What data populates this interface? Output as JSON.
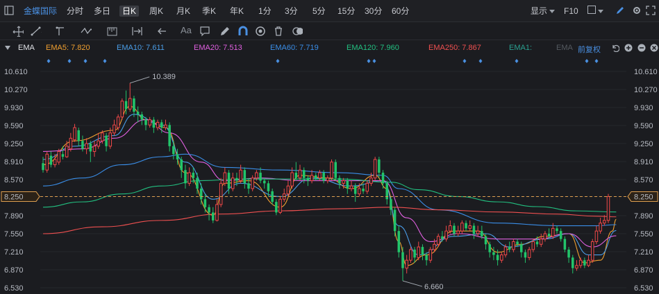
{
  "toolbar": {
    "stock_name": "金蝶国际",
    "periods": [
      "分时",
      "多日",
      "日K",
      "周K",
      "月K",
      "季K",
      "年K",
      "1分",
      "3分",
      "5分",
      "15分",
      "30分",
      "60分"
    ],
    "active_period": "日K",
    "display_label": "显示",
    "f10_label": "F10"
  },
  "drawing_tools": [
    "crosshair-icon",
    "line-icon",
    "ray-icon",
    "wave-icon",
    "ruler-icon",
    "range-icon",
    "arrow-left-icon",
    "text-icon",
    "comment-icon",
    "pen-icon",
    "magnet-icon",
    "eye-icon",
    "trash-icon",
    "toggle-icon"
  ],
  "drawing_text_tool": "Aa",
  "legend": {
    "indicator": "EMA",
    "items": [
      {
        "label": "EMA5: 7.820",
        "color": "#f0a030"
      },
      {
        "label": "EMA10: 7.611",
        "color": "#4a9ee8"
      },
      {
        "label": "EMA20: 7.513",
        "color": "#e060e0"
      },
      {
        "label": "EMA60: 7.719",
        "color": "#3a8ee8"
      },
      {
        "label": "EMA120: 7.960",
        "color": "#22c080"
      },
      {
        "label": "EMA250: 7.867",
        "color": "#f05050"
      },
      {
        "label": "EMA1:",
        "color": "#2aa090"
      },
      {
        "label": "EMA",
        "color": "#555a60"
      }
    ],
    "adjust_label": "前复权"
  },
  "chart_data": {
    "type": "candlestick",
    "y_ticks": [
      "10.610",
      "10.270",
      "9.930",
      "9.590",
      "9.250",
      "8.910",
      "8.570",
      "8.250",
      "7.890",
      "7.550",
      "7.210",
      "6.870",
      "6.530"
    ],
    "ylim": [
      6.53,
      10.61
    ],
    "current_price": "8.250",
    "annotations": {
      "high": "10.389",
      "low": "6.660"
    },
    "colors": {
      "up": "#f04848",
      "down": "#22c46a",
      "background": "#1b1c20",
      "price_line": "#e0a050"
    },
    "candles": [
      [
        8.88,
        8.75,
        9.0,
        8.7
      ],
      [
        8.75,
        9.05,
        9.1,
        8.7
      ],
      [
        9.02,
        8.85,
        9.1,
        8.8
      ],
      [
        8.85,
        8.95,
        9.05,
        8.8
      ],
      [
        8.9,
        9.1,
        9.15,
        8.85
      ],
      [
        9.05,
        9.0,
        9.2,
        8.95
      ],
      [
        9.0,
        9.2,
        9.3,
        8.98
      ],
      [
        9.15,
        9.35,
        9.45,
        9.1
      ],
      [
        9.32,
        9.55,
        9.62,
        9.28
      ],
      [
        9.5,
        9.3,
        9.55,
        9.2
      ],
      [
        9.3,
        9.15,
        9.4,
        9.1
      ],
      [
        9.15,
        9.25,
        9.35,
        9.05
      ],
      [
        9.25,
        9.1,
        9.3,
        8.9
      ],
      [
        9.1,
        9.2,
        9.3,
        9.0
      ],
      [
        9.2,
        9.3,
        9.45,
        9.15
      ],
      [
        9.3,
        9.45,
        9.5,
        9.25
      ],
      [
        9.4,
        9.2,
        9.45,
        9.1
      ],
      [
        9.2,
        9.45,
        9.55,
        9.15
      ],
      [
        9.45,
        9.6,
        9.7,
        9.4
      ],
      [
        9.55,
        9.75,
        9.8,
        9.5
      ],
      [
        9.75,
        10.05,
        10.1,
        9.7
      ],
      [
        10.05,
        9.9,
        10.25,
        9.8
      ],
      [
        9.9,
        10.1,
        10.39,
        9.85
      ],
      [
        10.1,
        9.85,
        10.15,
        9.75
      ],
      [
        9.85,
        9.8,
        9.95,
        9.65
      ],
      [
        9.8,
        9.7,
        9.85,
        9.6
      ],
      [
        9.7,
        9.6,
        9.75,
        9.5
      ],
      [
        9.6,
        9.7,
        9.75,
        9.55
      ],
      [
        9.7,
        9.55,
        9.75,
        9.45
      ],
      [
        9.55,
        9.65,
        9.7,
        9.5
      ],
      [
        9.65,
        9.55,
        9.7,
        9.45
      ],
      [
        9.55,
        9.6,
        9.7,
        9.5
      ],
      [
        9.6,
        9.2,
        9.65,
        9.1
      ],
      [
        9.2,
        9.05,
        9.3,
        8.95
      ],
      [
        9.05,
        8.95,
        9.15,
        8.85
      ],
      [
        8.95,
        8.75,
        9.0,
        8.6
      ],
      [
        8.75,
        8.5,
        8.85,
        8.4
      ],
      [
        8.5,
        8.7,
        8.8,
        8.45
      ],
      [
        8.7,
        8.6,
        8.8,
        8.5
      ],
      [
        8.6,
        8.4,
        8.7,
        8.3
      ],
      [
        8.4,
        8.2,
        8.5,
        8.1
      ],
      [
        8.2,
        8.05,
        8.3,
        7.95
      ],
      [
        8.05,
        7.95,
        8.1,
        7.8
      ],
      [
        7.95,
        7.8,
        8.05,
        7.75
      ],
      [
        7.8,
        8.1,
        8.2,
        7.78
      ],
      [
        8.1,
        8.5,
        8.6,
        8.05
      ],
      [
        8.5,
        8.7,
        8.8,
        8.45
      ],
      [
        8.7,
        8.4,
        8.75,
        8.3
      ],
      [
        8.4,
        8.6,
        8.7,
        8.35
      ],
      [
        8.6,
        8.55,
        8.7,
        8.45
      ],
      [
        8.55,
        8.75,
        8.85,
        8.5
      ],
      [
        8.75,
        8.5,
        8.8,
        8.4
      ],
      [
        8.5,
        8.4,
        8.6,
        8.3
      ],
      [
        8.4,
        8.6,
        8.65,
        8.35
      ],
      [
        8.6,
        8.7,
        8.75,
        8.55
      ],
      [
        8.7,
        8.55,
        8.8,
        8.5
      ],
      [
        8.55,
        8.5,
        8.6,
        8.4
      ],
      [
        8.5,
        8.35,
        8.55,
        8.25
      ],
      [
        8.35,
        8.15,
        8.4,
        8.1
      ],
      [
        8.15,
        7.95,
        8.2,
        7.9
      ],
      [
        7.95,
        8.2,
        8.25,
        7.92
      ],
      [
        8.2,
        8.3,
        8.4,
        8.15
      ],
      [
        8.3,
        8.45,
        8.55,
        8.25
      ],
      [
        8.45,
        8.7,
        8.8,
        8.4
      ],
      [
        8.7,
        8.6,
        8.9,
        8.55
      ],
      [
        8.6,
        8.75,
        8.85,
        8.55
      ],
      [
        8.75,
        8.6,
        8.8,
        8.5
      ],
      [
        8.6,
        8.55,
        8.65,
        8.45
      ],
      [
        8.55,
        8.65,
        8.75,
        8.5
      ],
      [
        8.65,
        8.6,
        8.7,
        8.55
      ],
      [
        8.6,
        8.7,
        8.75,
        8.55
      ],
      [
        8.7,
        8.55,
        8.75,
        8.5
      ],
      [
        8.55,
        8.6,
        8.65,
        8.5
      ],
      [
        8.6,
        8.9,
        8.95,
        8.55
      ],
      [
        8.9,
        8.6,
        8.95,
        8.55
      ],
      [
        8.6,
        8.5,
        8.65,
        8.4
      ],
      [
        8.5,
        8.55,
        8.6,
        8.4
      ],
      [
        8.55,
        8.4,
        8.6,
        8.3
      ],
      [
        8.4,
        8.45,
        8.55,
        8.35
      ],
      [
        8.45,
        8.3,
        8.5,
        8.15
      ],
      [
        8.3,
        8.4,
        8.5,
        8.25
      ],
      [
        8.4,
        8.35,
        8.5,
        8.3
      ],
      [
        8.35,
        8.5,
        8.55,
        8.3
      ],
      [
        8.5,
        8.6,
        8.7,
        8.45
      ],
      [
        8.6,
        8.95,
        9.0,
        8.55
      ],
      [
        8.95,
        8.7,
        9.0,
        8.6
      ],
      [
        8.7,
        8.5,
        8.75,
        8.4
      ],
      [
        8.5,
        8.2,
        8.55,
        8.1
      ],
      [
        8.2,
        8.0,
        8.25,
        7.9
      ],
      [
        8.0,
        7.6,
        8.05,
        7.5
      ],
      [
        7.6,
        7.2,
        7.7,
        7.1
      ],
      [
        7.2,
        6.9,
        7.3,
        6.66
      ],
      [
        6.9,
        7.05,
        7.15,
        6.8
      ],
      [
        7.05,
        7.25,
        7.3,
        7.0
      ],
      [
        7.25,
        7.1,
        7.3,
        7.0
      ],
      [
        7.1,
        7.3,
        7.4,
        7.05
      ],
      [
        7.3,
        7.15,
        7.35,
        7.05
      ],
      [
        7.15,
        7.05,
        7.2,
        6.95
      ],
      [
        7.05,
        7.25,
        7.3,
        7.0
      ],
      [
        7.25,
        7.35,
        7.45,
        7.2
      ],
      [
        7.35,
        7.5,
        7.55,
        7.3
      ],
      [
        7.5,
        7.45,
        7.6,
        7.4
      ],
      [
        7.45,
        7.6,
        7.7,
        7.4
      ],
      [
        7.6,
        7.7,
        7.8,
        7.55
      ],
      [
        7.7,
        7.55,
        7.75,
        7.5
      ],
      [
        7.55,
        7.6,
        7.7,
        7.5
      ],
      [
        7.6,
        7.75,
        7.8,
        7.55
      ],
      [
        7.75,
        7.65,
        7.8,
        7.6
      ],
      [
        7.65,
        7.7,
        7.8,
        7.6
      ],
      [
        7.7,
        7.55,
        7.75,
        7.45
      ],
      [
        7.55,
        7.6,
        7.7,
        7.5
      ],
      [
        7.6,
        7.5,
        7.7,
        7.45
      ],
      [
        7.5,
        7.35,
        7.55,
        7.25
      ],
      [
        7.35,
        7.2,
        7.4,
        7.1
      ],
      [
        7.2,
        7.15,
        7.3,
        7.05
      ],
      [
        7.15,
        7.05,
        7.25,
        6.95
      ],
      [
        7.05,
        7.15,
        7.2,
        7.0
      ],
      [
        7.15,
        7.3,
        7.35,
        7.1
      ],
      [
        7.3,
        7.25,
        7.4,
        7.2
      ],
      [
        7.25,
        7.4,
        7.45,
        7.2
      ],
      [
        7.4,
        7.35,
        7.45,
        7.3
      ],
      [
        7.35,
        7.2,
        7.4,
        7.1
      ],
      [
        7.2,
        7.1,
        7.25,
        7.0
      ],
      [
        7.1,
        7.25,
        7.3,
        7.05
      ],
      [
        7.25,
        7.4,
        7.45,
        7.2
      ],
      [
        7.4,
        7.35,
        7.5,
        7.3
      ],
      [
        7.35,
        7.45,
        7.55,
        7.3
      ],
      [
        7.45,
        7.55,
        7.6,
        7.4
      ],
      [
        7.55,
        7.5,
        7.65,
        7.45
      ],
      [
        7.5,
        7.65,
        7.75,
        7.45
      ],
      [
        7.65,
        7.6,
        7.7,
        7.55
      ],
      [
        7.6,
        7.45,
        7.65,
        7.4
      ],
      [
        7.45,
        7.25,
        7.5,
        7.2
      ],
      [
        7.25,
        7.1,
        7.3,
        7.0
      ],
      [
        7.1,
        6.9,
        7.15,
        6.8
      ],
      [
        6.9,
        6.95,
        7.05,
        6.85
      ],
      [
        6.95,
        7.05,
        7.1,
        6.9
      ],
      [
        7.05,
        6.95,
        7.1,
        6.9
      ],
      [
        6.95,
        7.05,
        7.15,
        6.92
      ],
      [
        7.05,
        7.4,
        7.45,
        7.0
      ],
      [
        7.4,
        7.6,
        7.7,
        7.35
      ],
      [
        7.6,
        7.75,
        7.85,
        7.55
      ],
      [
        7.75,
        7.8,
        7.9,
        7.7
      ],
      [
        7.8,
        8.25,
        8.3,
        7.75
      ]
    ],
    "ema": {
      "EMA5": [
        [
          0,
          8.85
        ],
        [
          8,
          9.3
        ],
        [
          18,
          9.5
        ],
        [
          22,
          9.95
        ],
        [
          26,
          9.7
        ],
        [
          31,
          9.55
        ],
        [
          36,
          8.7
        ],
        [
          43,
          7.9
        ],
        [
          46,
          8.5
        ],
        [
          52,
          8.55
        ],
        [
          60,
          8.05
        ],
        [
          65,
          8.65
        ],
        [
          72,
          8.6
        ],
        [
          78,
          8.4
        ],
        [
          84,
          8.65
        ],
        [
          87,
          8.4
        ],
        [
          90,
          7.4
        ],
        [
          92,
          6.95
        ],
        [
          97,
          7.15
        ],
        [
          104,
          7.6
        ],
        [
          110,
          7.6
        ],
        [
          115,
          7.2
        ],
        [
          121,
          7.35
        ],
        [
          127,
          7.5
        ],
        [
          133,
          7.55
        ],
        [
          137,
          7.0
        ],
        [
          141,
          7.05
        ],
        [
          144,
          7.6
        ],
        [
          145,
          7.82
        ]
      ],
      "EMA10": [
        [
          0,
          8.95
        ],
        [
          8,
          9.2
        ],
        [
          18,
          9.4
        ],
        [
          23,
          9.8
        ],
        [
          30,
          9.6
        ],
        [
          36,
          8.9
        ],
        [
          43,
          8.2
        ],
        [
          50,
          8.5
        ],
        [
          60,
          8.25
        ],
        [
          68,
          8.6
        ],
        [
          78,
          8.45
        ],
        [
          86,
          8.55
        ],
        [
          90,
          7.7
        ],
        [
          95,
          7.15
        ],
        [
          104,
          7.5
        ],
        [
          112,
          7.55
        ],
        [
          118,
          7.3
        ],
        [
          127,
          7.45
        ],
        [
          133,
          7.55
        ],
        [
          138,
          7.15
        ],
        [
          141,
          7.15
        ],
        [
          145,
          7.61
        ]
      ],
      "EMA20": [
        [
          0,
          9.1
        ],
        [
          10,
          9.15
        ],
        [
          18,
          9.35
        ],
        [
          26,
          9.7
        ],
        [
          32,
          9.45
        ],
        [
          40,
          8.9
        ],
        [
          46,
          8.55
        ],
        [
          55,
          8.6
        ],
        [
          65,
          8.55
        ],
        [
          75,
          8.55
        ],
        [
          86,
          8.55
        ],
        [
          92,
          7.85
        ],
        [
          98,
          7.4
        ],
        [
          105,
          7.55
        ],
        [
          115,
          7.45
        ],
        [
          125,
          7.45
        ],
        [
          133,
          7.55
        ],
        [
          139,
          7.3
        ],
        [
          145,
          7.51
        ]
      ],
      "EMA60": [
        [
          0,
          8.45
        ],
        [
          10,
          8.6
        ],
        [
          20,
          8.85
        ],
        [
          30,
          9.0
        ],
        [
          36,
          9.05
        ],
        [
          46,
          8.8
        ],
        [
          60,
          8.75
        ],
        [
          75,
          8.7
        ],
        [
          86,
          8.65
        ],
        [
          90,
          8.4
        ],
        [
          100,
          8.0
        ],
        [
          115,
          7.75
        ],
        [
          130,
          7.7
        ],
        [
          140,
          7.7
        ],
        [
          145,
          7.72
        ]
      ],
      "EMA120": [
        [
          0,
          8.05
        ],
        [
          10,
          8.15
        ],
        [
          20,
          8.3
        ],
        [
          30,
          8.45
        ],
        [
          40,
          8.55
        ],
        [
          50,
          8.58
        ],
        [
          60,
          8.58
        ],
        [
          75,
          8.58
        ],
        [
          88,
          8.52
        ],
        [
          95,
          8.38
        ],
        [
          105,
          8.25
        ],
        [
          115,
          8.15
        ],
        [
          125,
          8.06
        ],
        [
          135,
          7.98
        ],
        [
          145,
          7.96
        ]
      ],
      "EMA250": [
        [
          0,
          7.55
        ],
        [
          15,
          7.68
        ],
        [
          30,
          7.8
        ],
        [
          45,
          7.92
        ],
        [
          60,
          7.98
        ],
        [
          75,
          8.02
        ],
        [
          88,
          8.05
        ],
        [
          100,
          8.0
        ],
        [
          115,
          7.96
        ],
        [
          130,
          7.92
        ],
        [
          140,
          7.88
        ],
        [
          145,
          7.867
        ]
      ]
    }
  }
}
